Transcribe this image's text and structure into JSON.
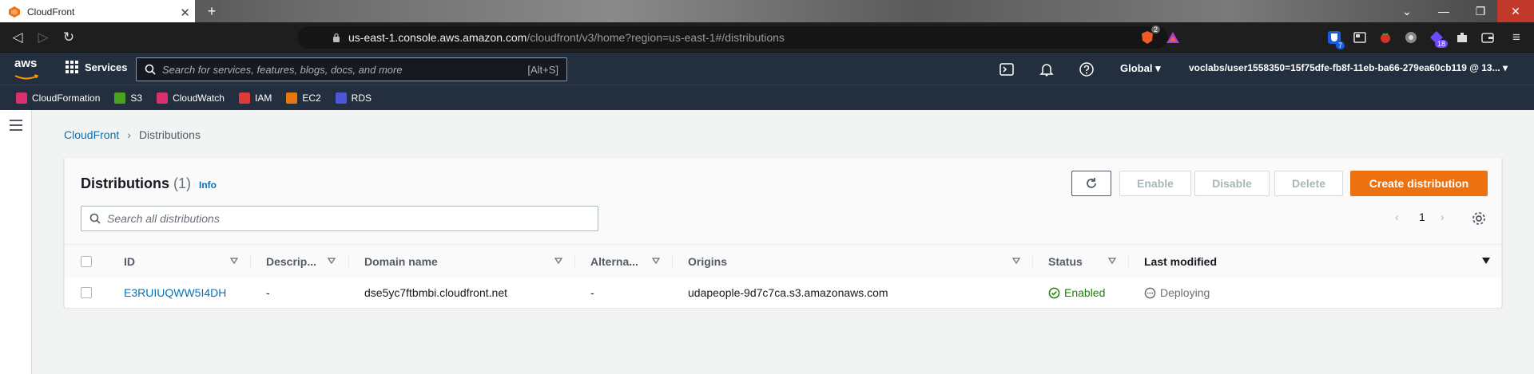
{
  "browser": {
    "tab_title": "CloudFront",
    "url_host": "us-east-1.console.aws.amazon.com",
    "url_path": "/cloudfront/v3/home?region=us-east-1#/distributions",
    "brave_badge": "2",
    "ext_badge_1": "7",
    "ext_badge_2": "18"
  },
  "aws_nav": {
    "logo_text": "aws",
    "services_label": "Services",
    "search_placeholder": "Search for services, features, blogs, docs, and more",
    "search_shortcut": "[Alt+S]",
    "region": "Global",
    "account": "voclabs/user1558350=15f75dfe-fb8f-11eb-ba66-279ea60cb119 @ 13..."
  },
  "favorites": [
    {
      "label": "CloudFormation",
      "color": "#d6336c"
    },
    {
      "label": "S3",
      "color": "#4aa31f"
    },
    {
      "label": "CloudWatch",
      "color": "#d6336c"
    },
    {
      "label": "IAM",
      "color": "#dd3b3b"
    },
    {
      "label": "EC2",
      "color": "#e8780d"
    },
    {
      "label": "RDS",
      "color": "#4d55d8"
    }
  ],
  "breadcrumb": {
    "root": "CloudFront",
    "current": "Distributions"
  },
  "panel": {
    "title": "Distributions",
    "count": "(1)",
    "info": "Info",
    "enable_label": "Enable",
    "disable_label": "Disable",
    "delete_label": "Delete",
    "create_label": "Create distribution",
    "search_placeholder": "Search all distributions",
    "page": "1"
  },
  "table": {
    "columns": [
      "ID",
      "Descrip...",
      "Domain name",
      "Alterna...",
      "Origins",
      "Status",
      "Last modified"
    ],
    "rows": [
      {
        "id": "E3RUIUQWW5I4DH",
        "description": "-",
        "domain": "dse5yc7ftbmbi.cloudfront.net",
        "alternate": "-",
        "origins": "udapeople-9d7c7ca.s3.amazonaws.com",
        "status": "Enabled",
        "last_modified": "Deploying"
      }
    ]
  },
  "colors": {
    "aws_nav": "#232f3e",
    "link": "#0073bb",
    "primary": "#ec7211",
    "success": "#1d8102"
  }
}
